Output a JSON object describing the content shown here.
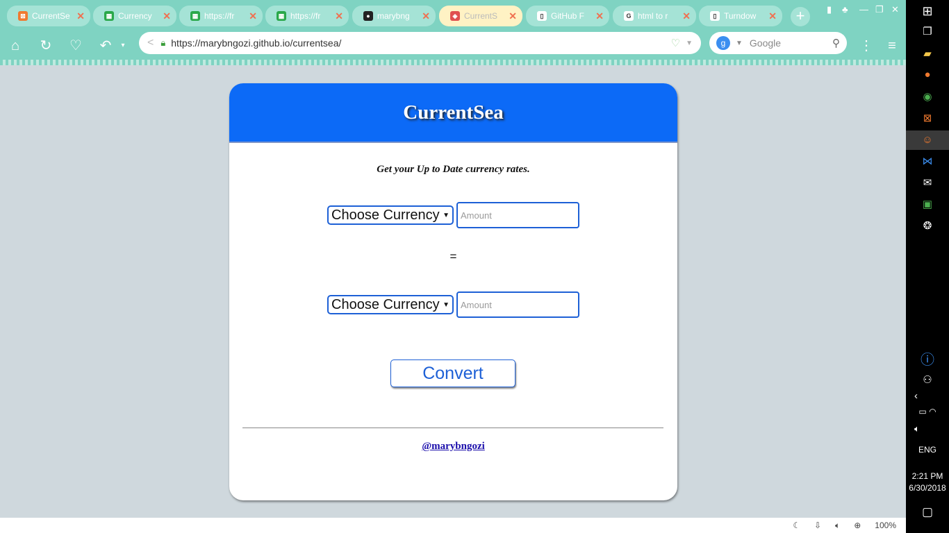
{
  "browser": {
    "tabs": [
      {
        "title": "CurrentSe",
        "fav_color": "#f07a2f",
        "fav_glyph": "⊠"
      },
      {
        "title": "Currency",
        "fav_color": "#2aa84a",
        "fav_glyph": "▦"
      },
      {
        "title": "https://fr",
        "fav_color": "#2aa84a",
        "fav_glyph": "▦"
      },
      {
        "title": "https://fr",
        "fav_color": "#2aa84a",
        "fav_glyph": "▦"
      },
      {
        "title": "marybng",
        "fav_color": "#222222",
        "fav_glyph": "●"
      },
      {
        "title": "CurrentS",
        "fav_color": "#e05050",
        "fav_glyph": "◈"
      },
      {
        "title": "GitHub F",
        "fav_color": "#ffffff",
        "fav_glyph": "▯"
      },
      {
        "title": "html to r",
        "fav_color": "#ffffff",
        "fav_glyph": "G"
      },
      {
        "title": "Turndow",
        "fav_color": "#ffffff",
        "fav_glyph": "▯"
      }
    ],
    "active_tab_index": 5,
    "url": "https://marybngozi.github.io/currentsea/",
    "search_placeholder": "Google",
    "zoom": "100%"
  },
  "page": {
    "title": "CurrentSea",
    "tagline": "Get your Up to Date currency rates.",
    "from": {
      "select_label": "Choose Currency",
      "amount_placeholder": "Amount"
    },
    "equals": "=",
    "to": {
      "select_label": "Choose Currency",
      "amount_placeholder": "Amount"
    },
    "convert_label": "Convert",
    "credit": "@marybngozi",
    "colors": {
      "header": "#0c6af7",
      "accent": "#1d60d6",
      "background": "#cfd8dd"
    }
  },
  "taskbar": {
    "language": "ENG",
    "time": "2:21 PM",
    "date": "6/30/2018"
  }
}
